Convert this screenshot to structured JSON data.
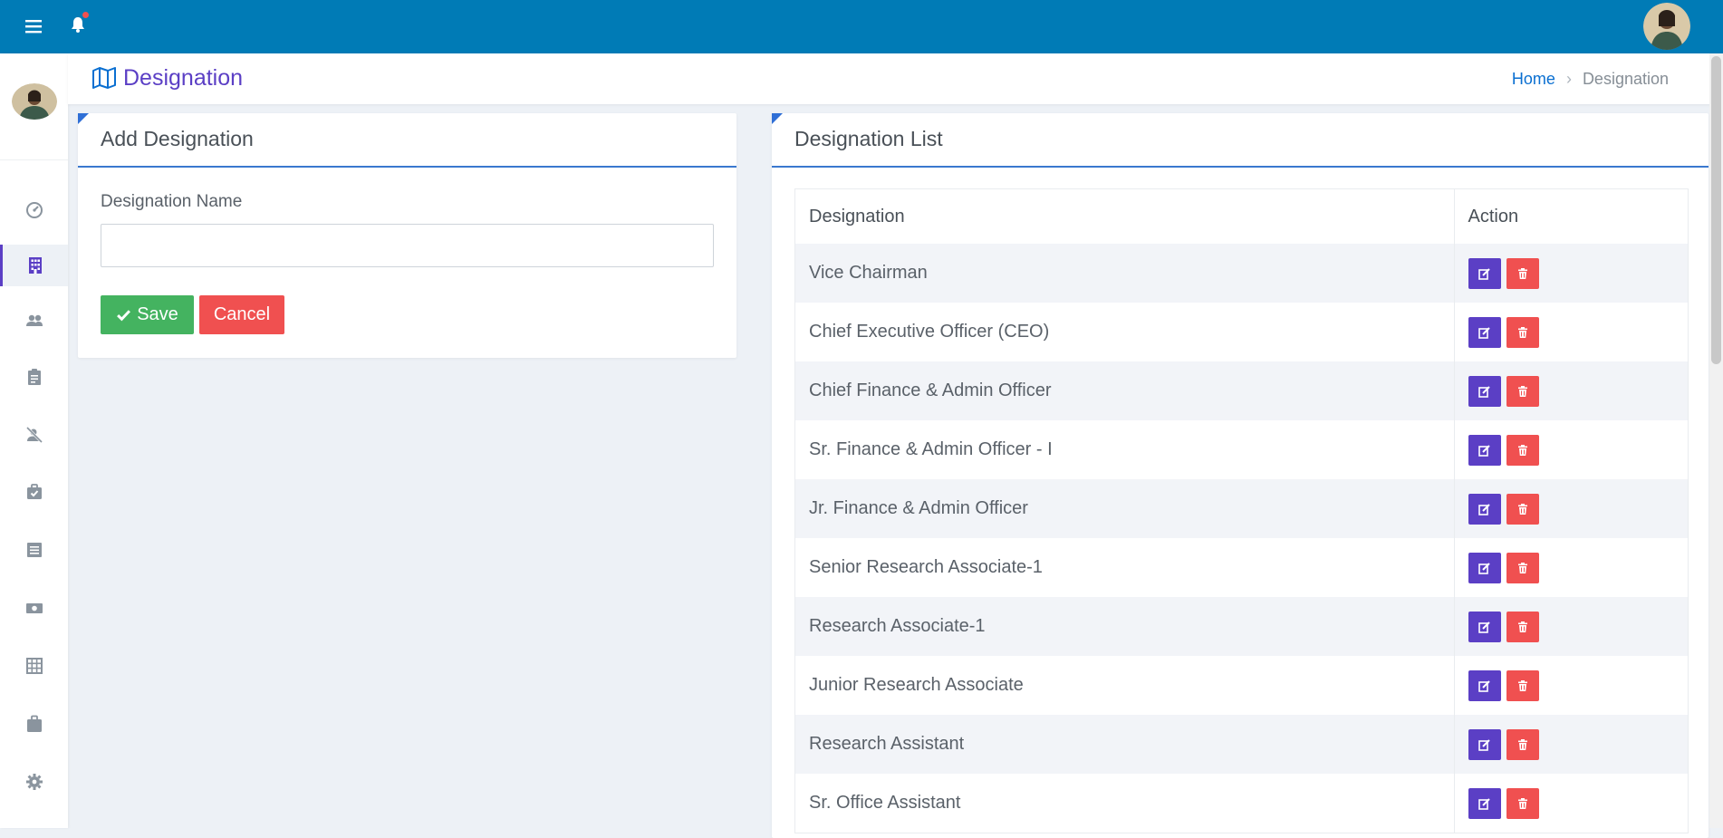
{
  "page": {
    "title": "Designation",
    "breadcrumb": {
      "home": "Home",
      "current": "Designation"
    }
  },
  "sidebar": {
    "items": [
      {
        "icon": "dashboard-icon"
      },
      {
        "icon": "building-icon",
        "active": true
      },
      {
        "icon": "users-icon"
      },
      {
        "icon": "clipboard-icon"
      },
      {
        "icon": "user-off-icon"
      },
      {
        "icon": "briefcase-check-icon"
      },
      {
        "icon": "list-icon"
      },
      {
        "icon": "money-icon"
      },
      {
        "icon": "grid-icon"
      },
      {
        "icon": "case-icon"
      },
      {
        "icon": "gear-icon"
      }
    ]
  },
  "add_form": {
    "title": "Add Designation",
    "field_label": "Designation Name",
    "field_value": "",
    "field_placeholder": "",
    "save_label": "Save",
    "cancel_label": "Cancel"
  },
  "list": {
    "title": "Designation List",
    "columns": [
      "Designation",
      "Action"
    ],
    "rows": [
      "Vice Chairman",
      "Chief Executive Officer (CEO)",
      "Chief Finance & Admin Officer",
      "Sr. Finance & Admin Officer - I",
      "Jr. Finance & Admin Officer",
      "Senior Research Associate-1",
      "Research Associate-1",
      "Junior Research Associate",
      "Research Assistant",
      "Sr. Office Assistant"
    ]
  },
  "colors": {
    "topbar": "#007bb6",
    "accent": "#5b3fc5",
    "save": "#44b360",
    "danger": "#f05050",
    "link": "#0a6fd1"
  }
}
